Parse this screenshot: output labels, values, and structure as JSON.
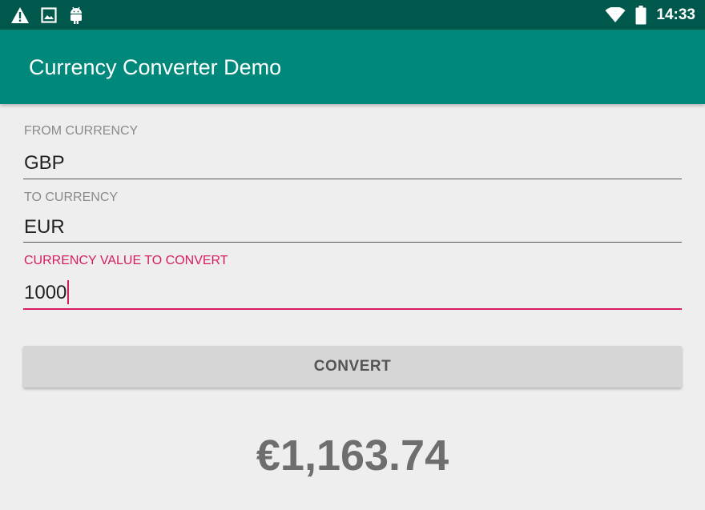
{
  "status_bar": {
    "time": "14:33",
    "icons": [
      "warning-icon",
      "image-icon",
      "android-icon",
      "wifi-icon",
      "battery-icon"
    ]
  },
  "app_bar": {
    "title": "Currency Converter Demo",
    "color": "#00897b"
  },
  "form": {
    "from_currency": {
      "label": "FROM CURRENCY",
      "value": "GBP"
    },
    "to_currency": {
      "label": "TO CURRENCY",
      "value": "EUR"
    },
    "amount": {
      "label": "CURRENCY VALUE TO CONVERT",
      "value": "1000",
      "focused": true
    }
  },
  "convert_button": {
    "label": "CONVERT"
  },
  "result": {
    "text": "€1,163.74"
  },
  "colors": {
    "status_bar": "#00574b",
    "accent": "#d81b60",
    "background": "#eeeeee"
  }
}
